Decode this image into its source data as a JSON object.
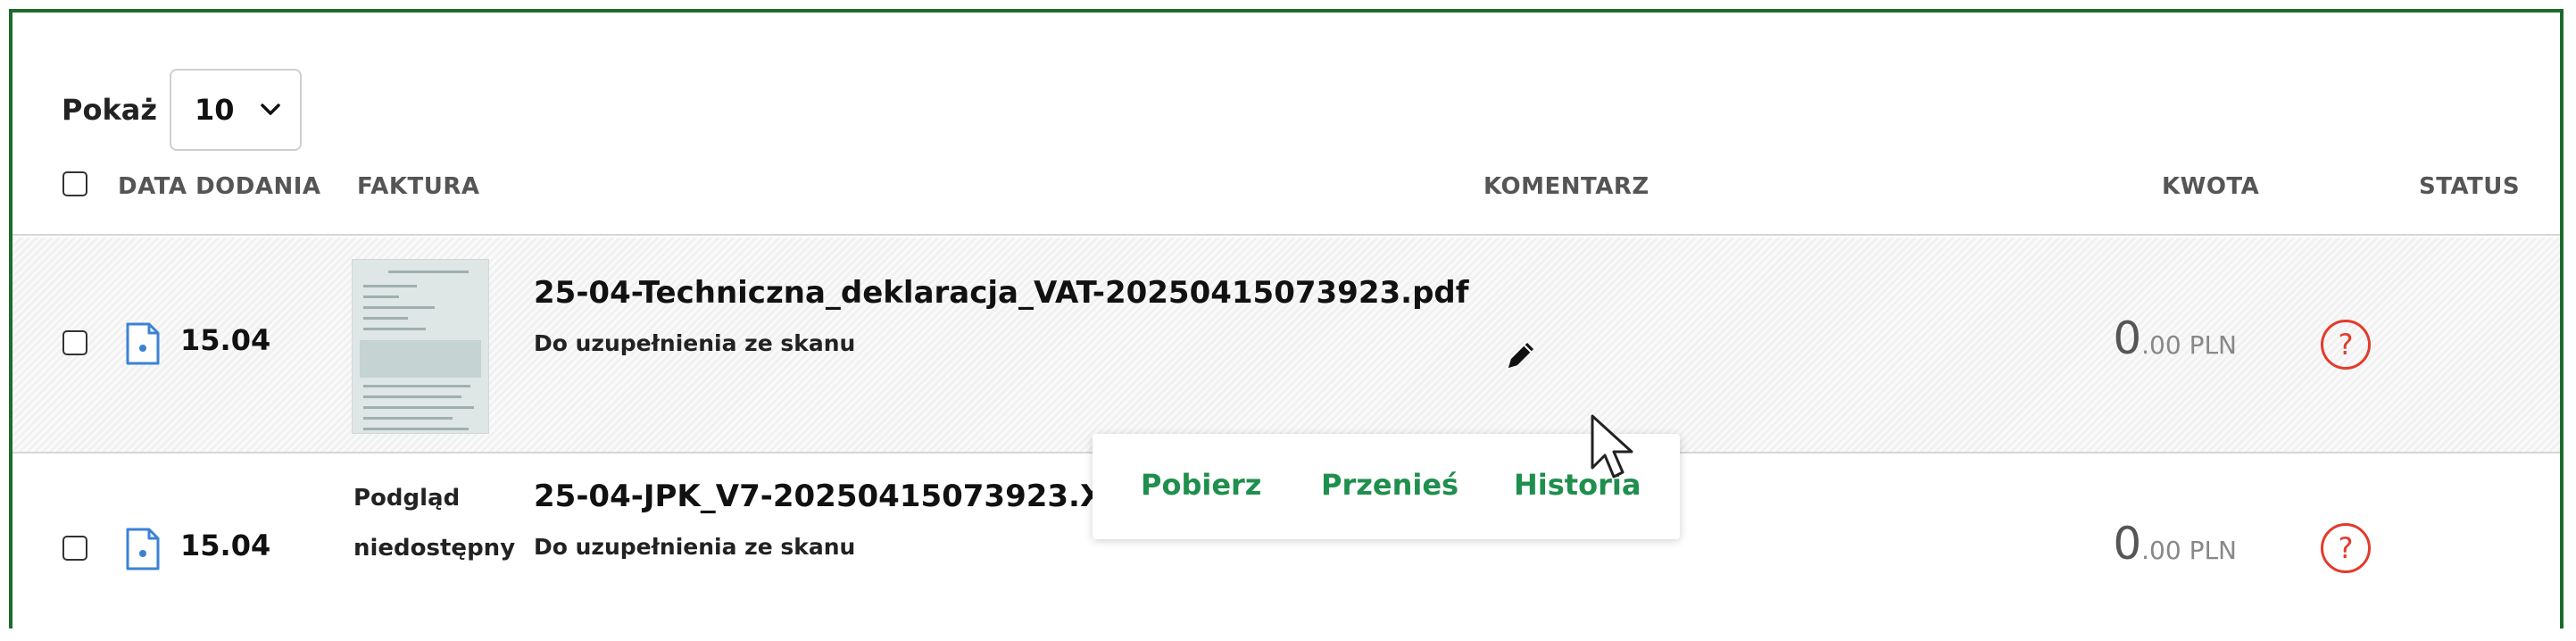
{
  "pagination": {
    "show_label": "Pokaż",
    "per_page": "10"
  },
  "table": {
    "headers": {
      "date": "DATA DODANIA",
      "invoice": "FAKTURA",
      "comment": "KOMENTARZ",
      "amount": "KWOTA",
      "status": "STATUS"
    },
    "rows": [
      {
        "date": "15.04",
        "file_name": "25-04-Techniczna_deklaracja_VAT-20250415073923.pdf",
        "subtitle": "Do uzupełnienia ze skanu",
        "amount_int": "0",
        "amount_dec": ".00 PLN",
        "status_icon": "question-icon",
        "status_symbol": "?"
      },
      {
        "date": "15.04",
        "preview_text": "Podgląd niedostępny",
        "file_name": "25-04-JPK_V7-20250415073923.XML",
        "subtitle": "Do uzupełnienia ze skanu",
        "amount_int": "0",
        "amount_dec": ".00 PLN",
        "status_icon": "question-icon",
        "status_symbol": "?"
      }
    ]
  },
  "popover": {
    "download": "Pobierz",
    "move": "Przenieś",
    "history": "Historia"
  },
  "colors": {
    "frame_border": "#1e6b2e",
    "link_green": "#1f8f4e",
    "status_red": "#e23b2c",
    "file_icon_blue": "#3b82d6"
  }
}
